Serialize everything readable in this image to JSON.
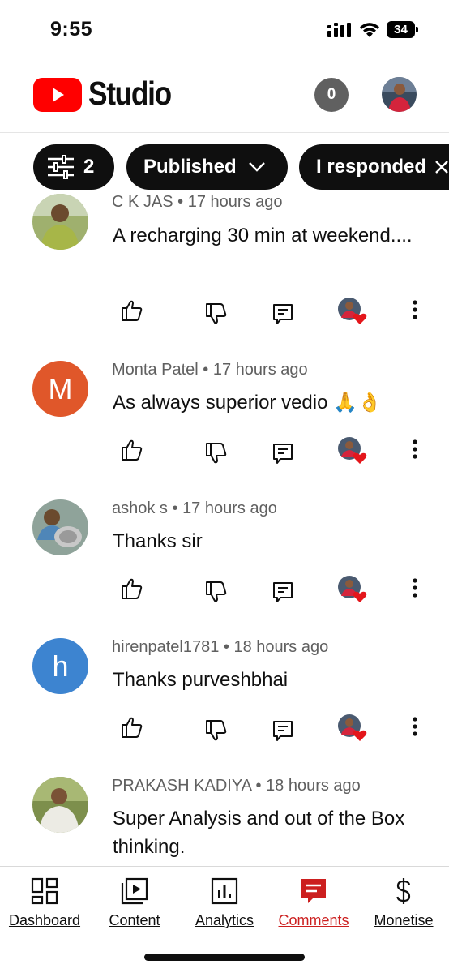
{
  "status_bar": {
    "time": "9:55",
    "battery": "34"
  },
  "header": {
    "title": "Studio",
    "notification_count": "0"
  },
  "chips": [
    {
      "label": "2"
    },
    {
      "label": "Published"
    },
    {
      "label": "I responded"
    }
  ],
  "comments": [
    {
      "author": "C K JAS",
      "time": "17 hours ago",
      "text": "A recharging 30 min at weekend....",
      "avatar_letter": "",
      "avatar_color": ""
    },
    {
      "author": "Monta Patel",
      "time": "17 hours ago",
      "text": "As always superior vedio 🙏👌",
      "avatar_letter": "M",
      "avatar_color": "#e0572a"
    },
    {
      "author": "ashok s",
      "time": "17 hours ago",
      "text": "Thanks sir",
      "avatar_letter": "",
      "avatar_color": ""
    },
    {
      "author": "hirenpatel1781",
      "time": "18 hours ago",
      "text": "Thanks purveshbhai",
      "avatar_letter": "h",
      "avatar_color": "#3d84d0"
    },
    {
      "author": "PRAKASH KADIYA",
      "time": "18 hours ago",
      "text": "Super Analysis and out of the Box thinking.",
      "avatar_letter": "",
      "avatar_color": ""
    }
  ],
  "bottom_nav": [
    {
      "label": "Dashboard",
      "icon": "dashboard-icon"
    },
    {
      "label": "Content",
      "icon": "content-icon"
    },
    {
      "label": "Analytics",
      "icon": "analytics-icon"
    },
    {
      "label": "Comments",
      "icon": "comments-icon",
      "active": true
    },
    {
      "label": "Monetise",
      "icon": "dollar-icon"
    }
  ],
  "colors": {
    "brand_red": "#ff0000",
    "active_nav": "#cc1f1f",
    "chip_bg": "#0f0f0f",
    "heart": "#e4161b"
  }
}
